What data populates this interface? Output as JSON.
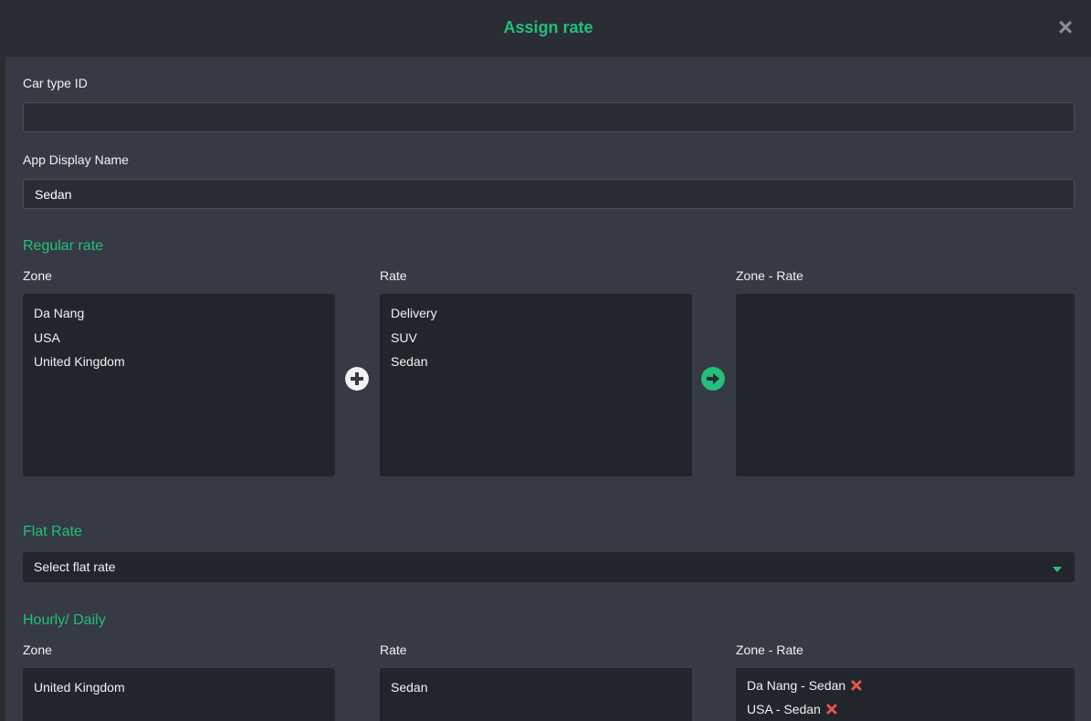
{
  "modal": {
    "title": "Assign rate",
    "close_icon": "close-icon"
  },
  "fields": {
    "car_type_id": {
      "label": "Car type ID",
      "value": ""
    },
    "app_display_name": {
      "label": "App Display Name",
      "value": "Sedan"
    }
  },
  "regular_rate": {
    "title": "Regular rate",
    "zone_label": "Zone",
    "rate_label": "Rate",
    "zone_rate_label": "Zone - Rate",
    "zones": [
      "Da Nang",
      "USA",
      "United Kingdom"
    ],
    "rates": [
      "Delivery",
      "SUV",
      "Sedan"
    ],
    "zone_rates": []
  },
  "flat_rate": {
    "title": "Flat Rate",
    "select_value": "Select flat rate"
  },
  "hourly_daily": {
    "title": "Hourly/ Daily",
    "zone_label": "Zone",
    "rate_label": "Rate",
    "zone_rate_label": "Zone - Rate",
    "zones": [
      "United Kingdom"
    ],
    "rates": [
      "Sedan"
    ],
    "zone_rates": [
      "Da Nang - Sedan",
      "USA - Sedan"
    ]
  },
  "colors": {
    "accent": "#22c07a",
    "remove": "#e4574a",
    "background": "#363a44"
  }
}
